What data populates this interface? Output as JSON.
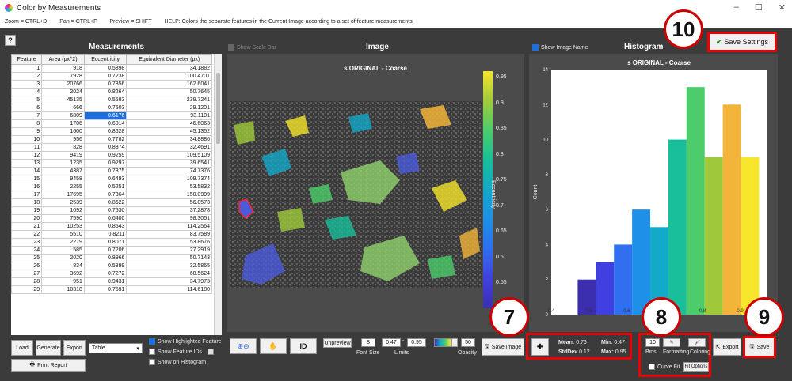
{
  "window": {
    "title": "Color by Measurements"
  },
  "menubar": {
    "zoom": "Zoom = CTRL+D",
    "pan": "Pan = CTRL+F",
    "preview": "Preview = SHIFT",
    "help": "HELP:  Colors the separate features in the Current Image according to a set of feature measurements"
  },
  "help_button": "?",
  "measurements": {
    "title": "Measurements",
    "columns": [
      "Feature",
      "Area (px^2)",
      "Eccentricity",
      "Equivalent Diameter (px)"
    ],
    "rows": [
      [
        "1",
        "918",
        "0.5898",
        "34.1882"
      ],
      [
        "2",
        "7928",
        "0.7238",
        "100.4701"
      ],
      [
        "3",
        "20766",
        "0.7856",
        "162.6041"
      ],
      [
        "4",
        "2024",
        "0.8264",
        "50.7645"
      ],
      [
        "5",
        "45135",
        "0.5583",
        "239.7241"
      ],
      [
        "6",
        "666",
        "0.7503",
        "29.1201"
      ],
      [
        "7",
        "6809",
        "0.6176",
        "93.1101"
      ],
      [
        "8",
        "1706",
        "0.6014",
        "46.6063"
      ],
      [
        "9",
        "1600",
        "0.8628",
        "45.1352"
      ],
      [
        "10",
        "956",
        "0.7782",
        "34.8886"
      ],
      [
        "11",
        "828",
        "0.8374",
        "32.4691"
      ],
      [
        "12",
        "9419",
        "0.9259",
        "109.5109"
      ],
      [
        "13",
        "1235",
        "0.9297",
        "39.6541"
      ],
      [
        "14",
        "4387",
        "0.7375",
        "74.7376"
      ],
      [
        "15",
        "9458",
        "0.6493",
        "109.7374"
      ],
      [
        "16",
        "2255",
        "0.5251",
        "53.5832"
      ],
      [
        "17",
        "17695",
        "0.7364",
        "150.0999"
      ],
      [
        "18",
        "2539",
        "0.8622",
        "56.8573"
      ],
      [
        "19",
        "1092",
        "0.7530",
        "37.2878"
      ],
      [
        "20",
        "7590",
        "0.6400",
        "98.3051"
      ],
      [
        "21",
        "10253",
        "0.8543",
        "114.2564"
      ],
      [
        "22",
        "5510",
        "0.8211",
        "83.7589"
      ],
      [
        "23",
        "2279",
        "0.8071",
        "53.8676"
      ],
      [
        "24",
        "585",
        "0.7206",
        "27.2919"
      ],
      [
        "25",
        "2020",
        "0.8966",
        "50.7143"
      ],
      [
        "26",
        "834",
        "0.5899",
        "32.5865"
      ],
      [
        "27",
        "3692",
        "0.7272",
        "68.5624"
      ],
      [
        "28",
        "951",
        "0.9431",
        "34.7973"
      ],
      [
        "29",
        "10318",
        "0.7591",
        "114.6180"
      ]
    ],
    "selected_row": 6,
    "selected_col": 2
  },
  "left_controls": {
    "load": "Load",
    "generate": "Generate",
    "export": "Export",
    "format_value": "Table",
    "print": "Print Report",
    "show_highlighted": "Show Highlighted Feature",
    "show_ids": "Show Feature IDs",
    "show_histogram": "Show on Histogram"
  },
  "image_panel": {
    "show_scale_bar": "Show Scale Bar",
    "title": "Image",
    "image_title": "s ORIGINAL - Coarse",
    "colorbar_label": "Eccentricity",
    "colorbar_ticks": [
      "0.95",
      "0.9",
      "0.85",
      "0.8",
      "0.75",
      "0.7",
      "0.65",
      "0.6",
      "0.55",
      "0.5"
    ]
  },
  "image_controls": {
    "id": "ID",
    "unpreview": "Unpreview",
    "font_size_value": "8",
    "font_size_label": "Font Size",
    "limit_min": "0.47",
    "limit_max": "0.95",
    "limits_label": "Limits",
    "opacity_value": "50",
    "opacity_label": "Opacity",
    "save_image": "Save Image"
  },
  "histogram_panel": {
    "show_image_name": "Show Image Name",
    "title": "Histogram",
    "chart_title": "s ORIGINAL - Coarse",
    "save_settings": "Save Settings"
  },
  "stats": {
    "mean_label": "Mean:",
    "mean": "0.76",
    "min_label": "Min:",
    "min": "0.47",
    "std_label": "StdDev",
    "std": "0.12",
    "max_label": "Max:",
    "max": "0.95"
  },
  "hist_controls": {
    "bins_value": "10",
    "bins_label": "Bins",
    "formatting_label": "Formatting",
    "coloring_label": "Coloring",
    "curve_fit": "Curve Fit",
    "fit_options": "Fit Options",
    "export": "Export",
    "save": "Save"
  },
  "callouts": {
    "c7": "7",
    "c8": "8",
    "c9": "9",
    "c10": "10"
  },
  "chart_data": {
    "type": "bar",
    "title": "s ORIGINAL - Coarse",
    "ylabel": "Count",
    "x_ticks": [
      "0.4",
      "0.5",
      "0.6",
      "0.7",
      "0.8",
      "0.9"
    ],
    "y_ticks": [
      "0",
      "2",
      "4",
      "6",
      "8",
      "10",
      "12",
      "14"
    ],
    "ylim": [
      0,
      14
    ],
    "xlim": [
      0.4,
      0.97
    ],
    "bin_starts": [
      0.47,
      0.518,
      0.566,
      0.614,
      0.662,
      0.71,
      0.758,
      0.806,
      0.854,
      0.902
    ],
    "bin_width": 0.048,
    "values": [
      2,
      3,
      4,
      6,
      5,
      10,
      13,
      9,
      12,
      9
    ],
    "colors": [
      "#3b2fb0",
      "#4040e0",
      "#2f6ff0",
      "#1e90e8",
      "#13a9c9",
      "#19be9a",
      "#4ccc6a",
      "#9fc93a",
      "#f2b43a",
      "#f6e52a"
    ]
  },
  "colors": {
    "accent_red": "#e00000",
    "selected_blue": "#1e6fd9"
  }
}
